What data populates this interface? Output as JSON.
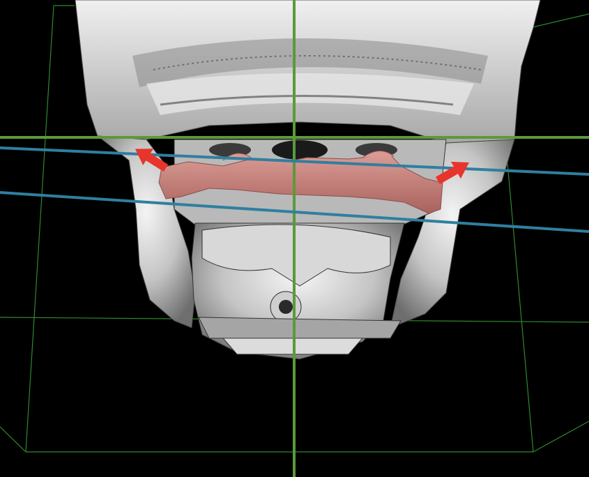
{
  "viewer": {
    "background_color": "#000000"
  },
  "model": {
    "bone_color": "#c9c9c9",
    "bone_highlight": "#f2f2f2",
    "bone_shadow": "#5a5a5a",
    "segment_color": "#c98580",
    "segment_shadow": "#8a4f4c"
  },
  "overlays": {
    "reference_line_color": "#5a9a3a",
    "bounding_box_color": "#2f8a2f",
    "axis_line_color": "#2f7fa0",
    "arrow_color": "#e8352b",
    "arrow_count": 2
  }
}
